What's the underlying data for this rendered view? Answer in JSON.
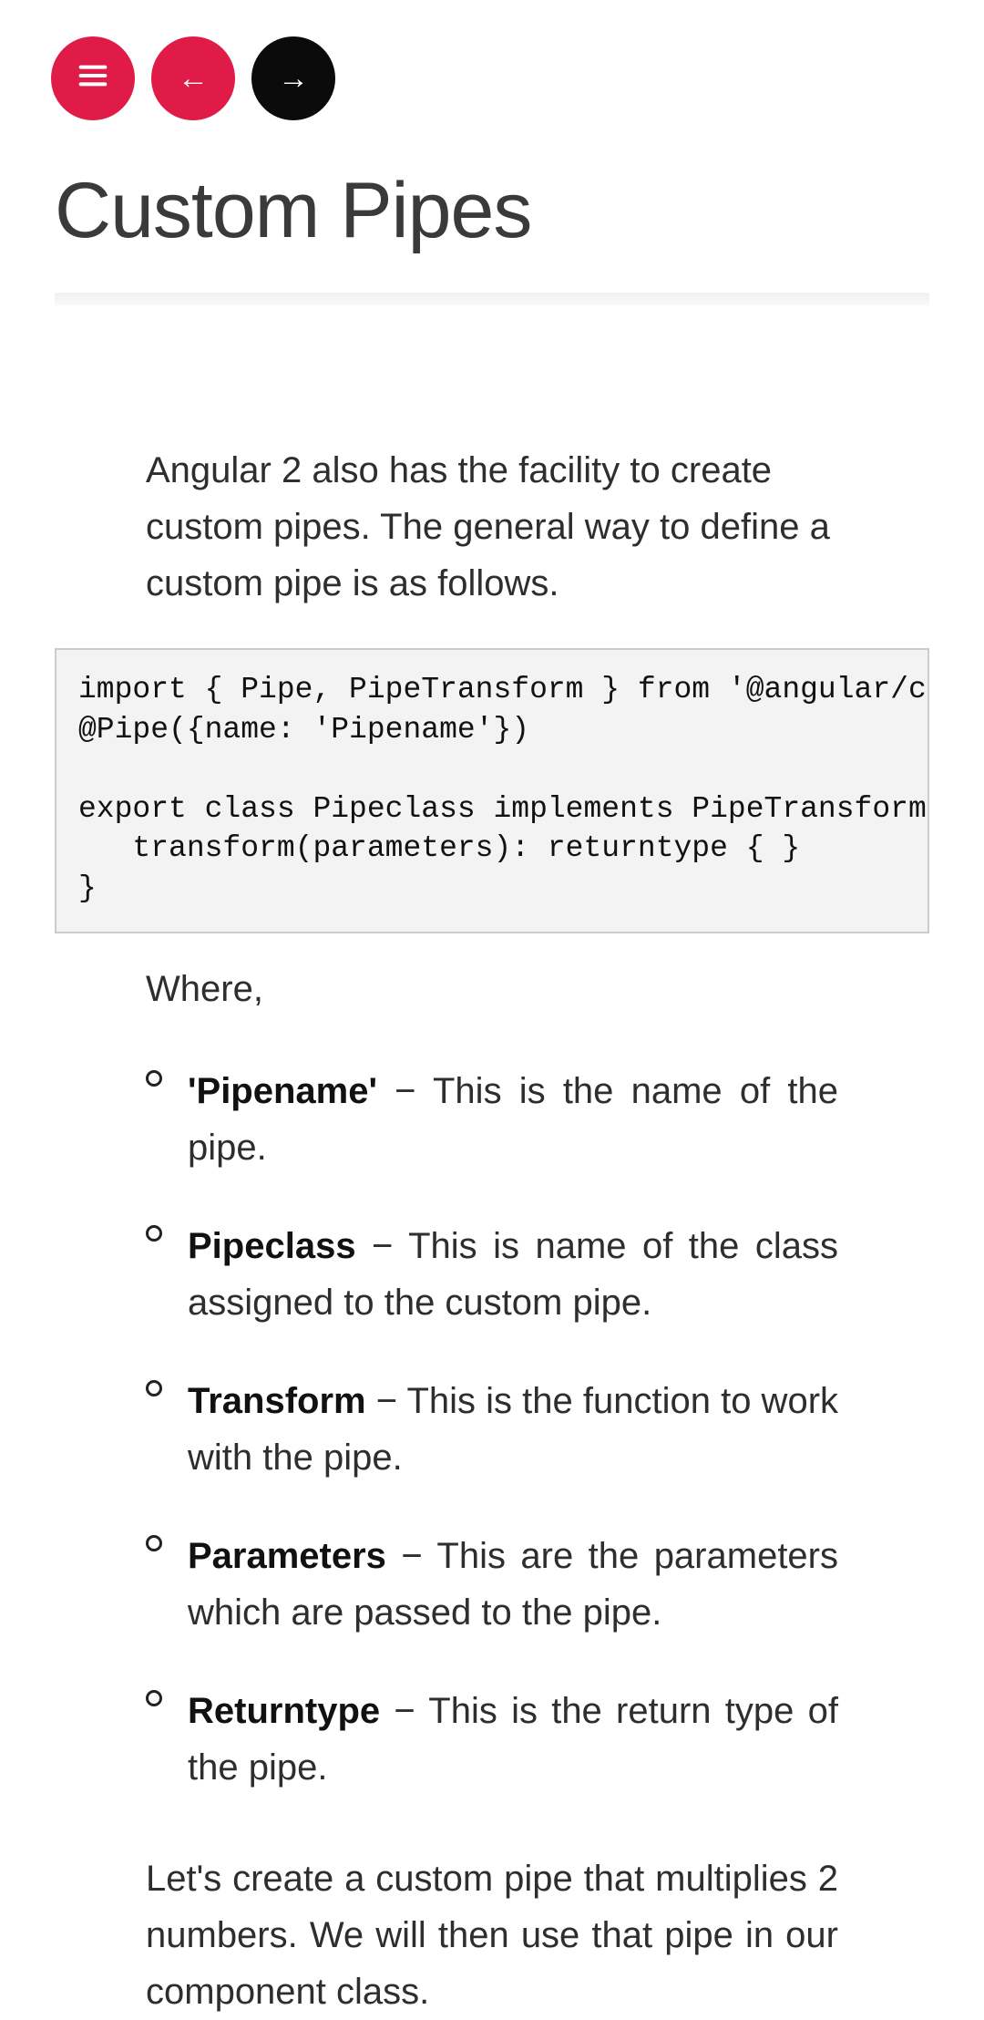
{
  "nav": {
    "menu_icon": "hamburger",
    "prev_label": "←",
    "next_label": "→"
  },
  "title": "Custom Pipes",
  "intro": "Angular 2 also has the facility to create custom pipes. The general way to define a custom pipe is as follows.",
  "code": "import { Pipe, PipeTransform } from '@angular/core';\n@Pipe({name: 'Pipename'})\n\nexport class Pipeclass implements PipeTransform {\n   transform(parameters): returntype { }\n}",
  "where_label": "Where,",
  "bullets": [
    {
      "term": "'Pipename'",
      "desc": " − This is the name of the pipe."
    },
    {
      "term": "Pipeclass",
      "desc": " − This is name of the class assigned to the custom pipe."
    },
    {
      "term": "Transform",
      "desc": " − This is the function to work with the pipe."
    },
    {
      "term": "Parameters",
      "desc": " − This are the parameters which are passed to the pipe."
    },
    {
      "term": "Returntype",
      "desc": " − This is the return type of the pipe."
    }
  ],
  "outro": "Let's create a custom pipe that multiplies 2 numbers. We will then use that pipe in our component class."
}
